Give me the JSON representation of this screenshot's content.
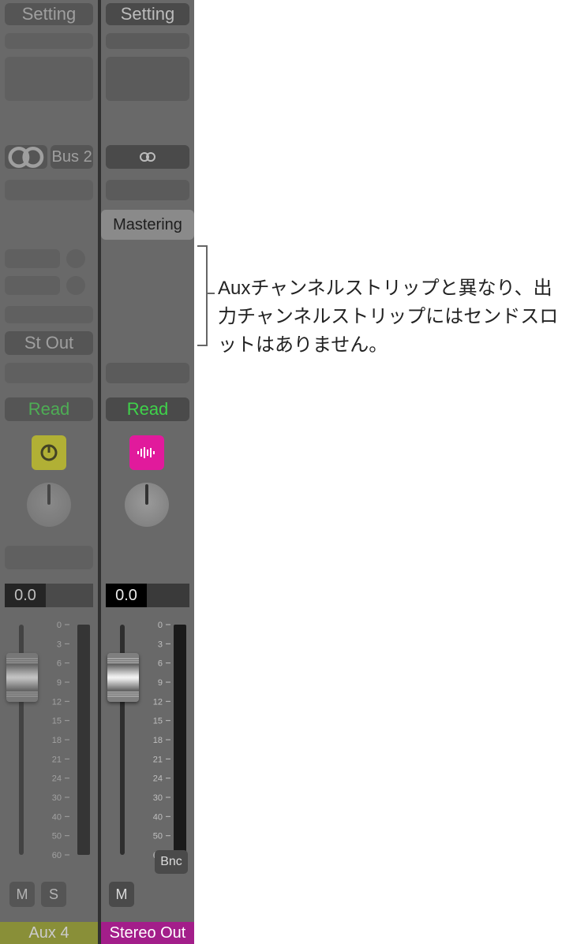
{
  "annotation": "Auxチャンネルストリップと異なり、出力チャンネルストリップにはセンドスロットはありません。",
  "strips": [
    {
      "setting_label": "Setting",
      "bus_label": "Bus 2",
      "output_label": "St Out",
      "automation_label": "Read",
      "value": "0.0",
      "mute_label": "M",
      "solo_label": "S",
      "name": "Aux 4",
      "name_color": "#9aa31e",
      "icon_bg": "#d8d61a"
    },
    {
      "setting_label": "Setting",
      "mastering_label": "Mastering",
      "automation_label": "Read",
      "value": "0.0",
      "mute_label": "M",
      "bnc_label": "Bnc",
      "name": "Stereo Out",
      "name_color": "#a31e8a",
      "icon_bg": "#e11a9c"
    }
  ],
  "meter_scale": [
    "0",
    "3",
    "6",
    "9",
    "12",
    "15",
    "18",
    "21",
    "24",
    "30",
    "40",
    "50",
    "60"
  ]
}
